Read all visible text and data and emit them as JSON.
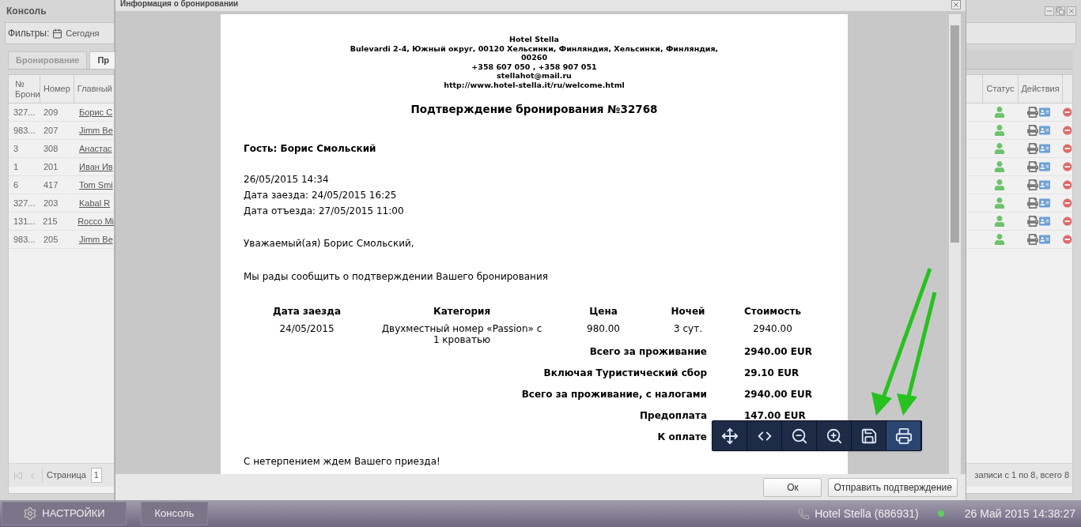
{
  "console": {
    "title": "Консоль",
    "filter_label": "Фильтры:",
    "filter_value": "Сегодня",
    "tabs": [
      {
        "label": "Бронирование",
        "selected": false
      },
      {
        "label": "Пр",
        "selected": true
      }
    ],
    "columns": [
      "№ Брони",
      "Номер",
      "Главный"
    ],
    "right_columns": [
      "Статус",
      "Действия"
    ],
    "rows": [
      {
        "booking": "327...",
        "room": "209",
        "guest": "Борис С"
      },
      {
        "booking": "983...",
        "room": "207",
        "guest": "Jimm Be"
      },
      {
        "booking": "3",
        "room": "308",
        "guest": "Анастас"
      },
      {
        "booking": "1",
        "room": "201",
        "guest": "Иван Ив"
      },
      {
        "booking": "6",
        "room": "417",
        "guest": "Tom Smi"
      },
      {
        "booking": "327...",
        "room": "203",
        "guest": "Kabal R"
      },
      {
        "booking": "131...",
        "room": "215",
        "guest": "Rocco Mi"
      },
      {
        "booking": "983...",
        "room": "205",
        "guest": "Jimm Be"
      }
    ],
    "pager": {
      "page_label": "Страница",
      "page": "1",
      "summary": "записи с 1 по 8, всего 8"
    }
  },
  "dialog": {
    "title": "Информация о бронировании",
    "document": {
      "hotel_lines": [
        "Hotel Stella",
        "Bulevardi 2-4, Южный округ, 00120 Хельсинки, Финляндия, Хельсинки, Финляндия,",
        "00260",
        "+358 607 050 , +358 907 051",
        "stellahot@mail.ru",
        "http://www.hotel-stella.it/ru/welcome.html"
      ],
      "heading": "Подтверждение бронирования №32768",
      "guest": "Гость: Борис Смольский",
      "dates": [
        "26/05/2015 14:34",
        "Дата заезда: 24/05/2015 16:25",
        "Дата отъезда: 27/05/2015 11:00"
      ],
      "greeting": "Уважаемый(ая) Борис Смольский,",
      "intro": "Мы рады сообщить о подтверждении Вашего бронирования",
      "table": {
        "columns": [
          "Дата заезда",
          "Категория",
          "Цена",
          "Ночей",
          "Стоимость"
        ],
        "rows": [
          [
            "24/05/2015",
            "Двухместный номер «Passion» с 1 кроватью",
            "980.00",
            "3 сут.",
            "2940.00"
          ]
        ]
      },
      "totals": [
        {
          "label": "Всего за проживание",
          "value": "2940.00 EUR"
        },
        {
          "label": "Включая Туристический сбор",
          "value": "29.10 EUR"
        },
        {
          "label": "Всего за проживание, с налогами",
          "value": "2940.00 EUR"
        },
        {
          "label": "Предоплата",
          "value": "147.00 EUR"
        },
        {
          "label": "К оплате"
        }
      ],
      "closing": "С нетерпением ждем Вашего приезда!"
    },
    "buttons": [
      "Ок",
      "Отправить подтверждение"
    ]
  },
  "taskbar": {
    "start": "НАСТРОЙКИ",
    "tasks": [
      "Консоль"
    ],
    "hotel": "Hotel Stella (686931)",
    "datetime": "26 Май 2015 14:38:27"
  }
}
